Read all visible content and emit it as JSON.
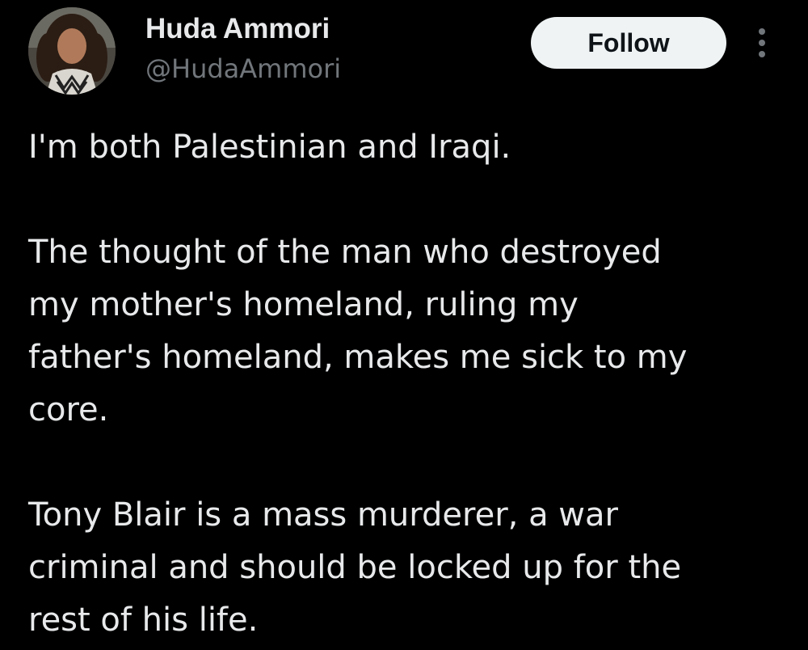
{
  "author": {
    "display_name": "Huda Ammori",
    "handle": "@HudaAmmori"
  },
  "actions": {
    "follow_label": "Follow",
    "more_icon": "more-vertical-icon"
  },
  "tweet": {
    "paragraphs": [
      "I'm both Palestinian and Iraqi.",
      "The thought of the man who destroyed\nmy mother's homeland, ruling my\nfather's homeland, makes me sick to my\ncore.",
      "Tony Blair is a mass murderer, a war\ncriminal and should be locked up for the\nrest of his life."
    ]
  },
  "colors": {
    "background": "#000000",
    "primary_text": "#e7e9ea",
    "secondary_text": "#71767b",
    "follow_bg": "#eff3f4",
    "follow_text": "#0f1419"
  }
}
